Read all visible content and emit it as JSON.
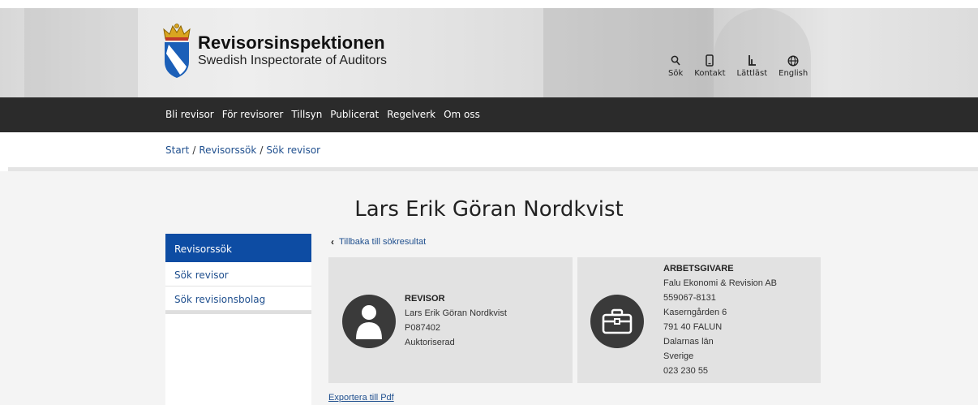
{
  "header": {
    "site_name": "Revisorsinspektionen",
    "site_subtitle": "Swedish Inspectorate of Auditors",
    "tools": [
      {
        "label": "Sök",
        "icon": "search-icon"
      },
      {
        "label": "Kontakt",
        "icon": "phone-icon"
      },
      {
        "label": "Lättläst",
        "icon": "easy-read-icon"
      },
      {
        "label": "English",
        "icon": "globe-icon"
      }
    ]
  },
  "nav": {
    "items": [
      "Bli revisor",
      "För revisorer",
      "Tillsyn",
      "Publicerat",
      "Regelverk",
      "Om oss"
    ]
  },
  "breadcrumb": {
    "items": [
      "Start",
      "Revisorssök",
      "Sök revisor"
    ],
    "separator": "/"
  },
  "page": {
    "title": "Lars Erik Göran Nordkvist"
  },
  "sidebar": {
    "heading": "Revisorssök",
    "items": [
      "Sök revisor",
      "Sök revisionsbolag"
    ]
  },
  "content": {
    "back_link": "Tillbaka till sökresultat",
    "auditor_card": {
      "icon": "person-icon",
      "heading": "REVISOR",
      "lines": [
        "Lars Erik Göran Nordkvist",
        "P087402",
        "Auktoriserad"
      ]
    },
    "employer_card": {
      "icon": "briefcase-icon",
      "heading": "ARBETSGIVARE",
      "lines": [
        "Falu Ekonomi & Revision AB",
        "559067-8131",
        "Kaserngården 6",
        "791 40 FALUN",
        "Dalarnas län",
        "Sverige",
        "023 230 55"
      ]
    },
    "export_link": "Exportera till Pdf"
  },
  "colors": {
    "nav_bg": "#2b2b2b",
    "sidebar_active": "#0d4ca3",
    "link": "#1f4f8e",
    "card_bg": "#e2e2e2",
    "icon_circle": "#3a3a3a"
  }
}
